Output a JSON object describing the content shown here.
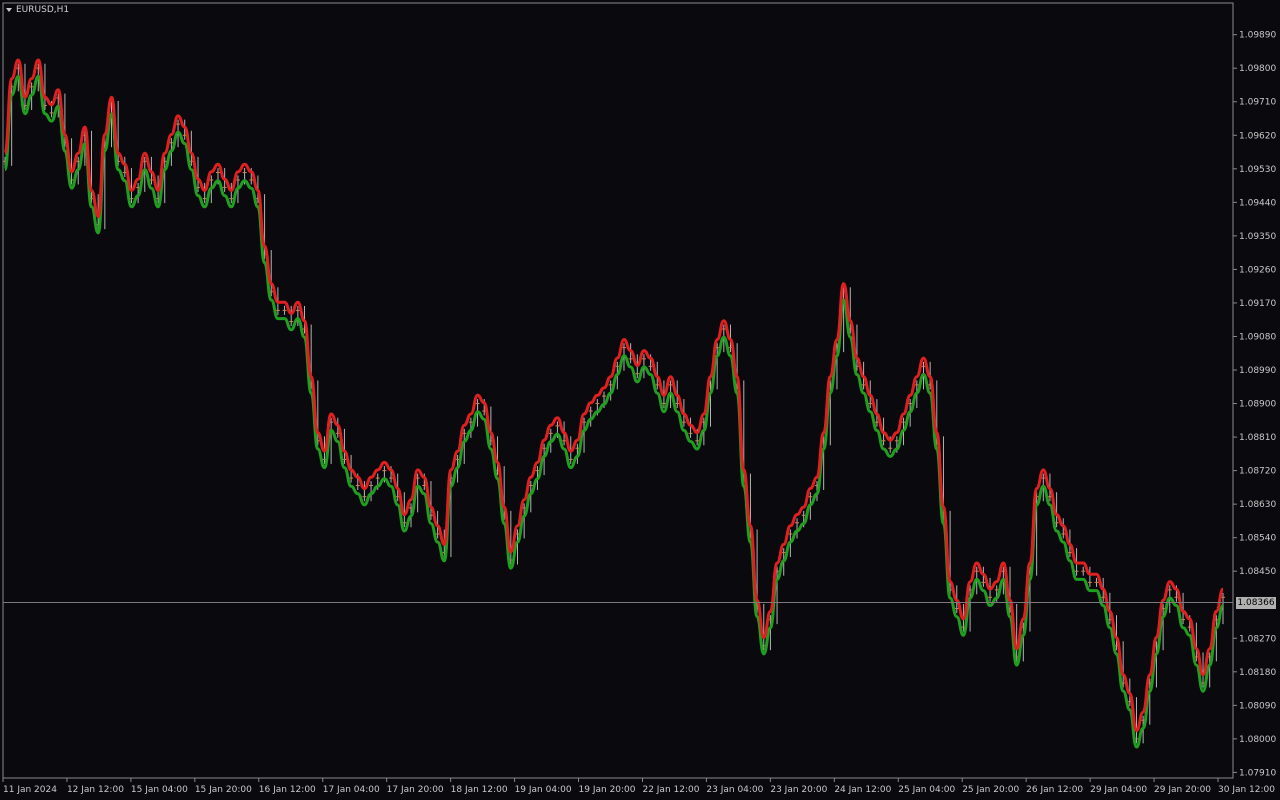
{
  "window": {
    "symbol_label": "EURUSD,H1"
  },
  "colors": {
    "background": "#0a0a0e",
    "axis": "#8a8a8a",
    "grid": "#1a1a22",
    "band_up": "#1f9e1f",
    "band_down": "#e02020",
    "candle": "#b4b4b4",
    "current_line": "#7a7a7a",
    "price_tag_bg": "#b0b0b0"
  },
  "chart_data": {
    "type": "line",
    "title": "EURUSD,H1",
    "ylim": [
      1.07895,
      1.09975
    ],
    "y_ticks": [
      "1.09890",
      "1.09800",
      "1.09710",
      "1.09620",
      "1.09530",
      "1.09440",
      "1.09350",
      "1.09260",
      "1.09170",
      "1.09080",
      "1.08990",
      "1.08900",
      "1.08810",
      "1.08720",
      "1.08630",
      "1.08540",
      "1.08450",
      "1.08366",
      "1.08270",
      "1.08180",
      "1.08090",
      "1.08000",
      "1.07910"
    ],
    "x_ticks": [
      "11 Jan 2024",
      "12 Jan 12:00",
      "15 Jan 04:00",
      "15 Jan 20:00",
      "16 Jan 12:00",
      "17 Jan 04:00",
      "17 Jan 20:00",
      "18 Jan 12:00",
      "19 Jan 04:00",
      "19 Jan 20:00",
      "22 Jan 12:00",
      "23 Jan 04:00",
      "23 Jan 20:00",
      "24 Jan 12:00",
      "25 Jan 04:00",
      "25 Jan 20:00",
      "26 Jan 12:00",
      "29 Jan 04:00",
      "29 Jan 20:00",
      "30 Jan 12:00"
    ],
    "current_price": "1.08366",
    "series": [
      {
        "values": [
          1.0955,
          1.0975,
          1.098,
          1.097,
          1.0975,
          1.098,
          1.097,
          1.0968,
          1.0972,
          1.096,
          1.095,
          1.0955,
          1.0962,
          1.0945,
          1.0938,
          1.096,
          1.097,
          1.0955,
          1.0952,
          1.0945,
          1.0948,
          1.0955,
          1.095,
          1.0945,
          1.0955,
          1.096,
          1.0965,
          1.0962,
          1.0955,
          1.0948,
          1.0945,
          1.095,
          1.0952,
          1.0948,
          1.0945,
          1.095,
          1.0952,
          1.095,
          1.0945,
          1.093,
          1.092,
          1.0915,
          1.0915,
          1.0912,
          1.0915,
          1.091,
          1.0895,
          1.088,
          1.0875,
          1.0885,
          1.0882,
          1.0875,
          1.087,
          1.0868,
          1.0865,
          1.0868,
          1.087,
          1.0872,
          1.087,
          1.0865,
          1.0858,
          1.0862,
          1.087,
          1.0868,
          1.086,
          1.0855,
          1.085,
          1.087,
          1.0875,
          1.0882,
          1.0885,
          1.089,
          1.0888,
          1.088,
          1.0872,
          1.086,
          1.0848,
          1.0855,
          1.0862,
          1.0868,
          1.0872,
          1.0878,
          1.0882,
          1.0884,
          1.088,
          1.0875,
          1.0878,
          1.0885,
          1.0888,
          1.089,
          1.0892,
          1.0895,
          1.09,
          1.0905,
          1.0902,
          1.0898,
          1.0902,
          1.09,
          1.0895,
          1.089,
          1.0895,
          1.089,
          1.0885,
          1.0882,
          1.088,
          1.0885,
          1.0895,
          1.0905,
          1.091,
          1.0905,
          1.0895,
          1.087,
          1.0855,
          1.0835,
          1.0825,
          1.0832,
          1.0845,
          1.085,
          1.0855,
          1.0858,
          1.086,
          1.0865,
          1.0868,
          1.088,
          1.0895,
          1.0905,
          1.092,
          1.091,
          1.09,
          1.0895,
          1.089,
          1.0885,
          1.088,
          1.0878,
          1.088,
          1.0885,
          1.089,
          1.0895,
          1.09,
          1.0895,
          1.088,
          1.086,
          1.084,
          1.0835,
          1.083,
          1.084,
          1.0845,
          1.0842,
          1.0838,
          1.084,
          1.0845,
          1.0835,
          1.0822,
          1.083,
          1.0845,
          1.0865,
          1.087,
          1.0865,
          1.0858,
          1.0855,
          1.085,
          1.0845,
          1.0845,
          1.0842,
          1.0842,
          1.0838,
          1.0832,
          1.0825,
          1.0815,
          1.081,
          1.08,
          1.0805,
          1.0815,
          1.0825,
          1.0835,
          1.084,
          1.0838,
          1.0832,
          1.083,
          1.0822,
          1.0815,
          1.0822,
          1.0832,
          1.0838
        ]
      }
    ]
  }
}
